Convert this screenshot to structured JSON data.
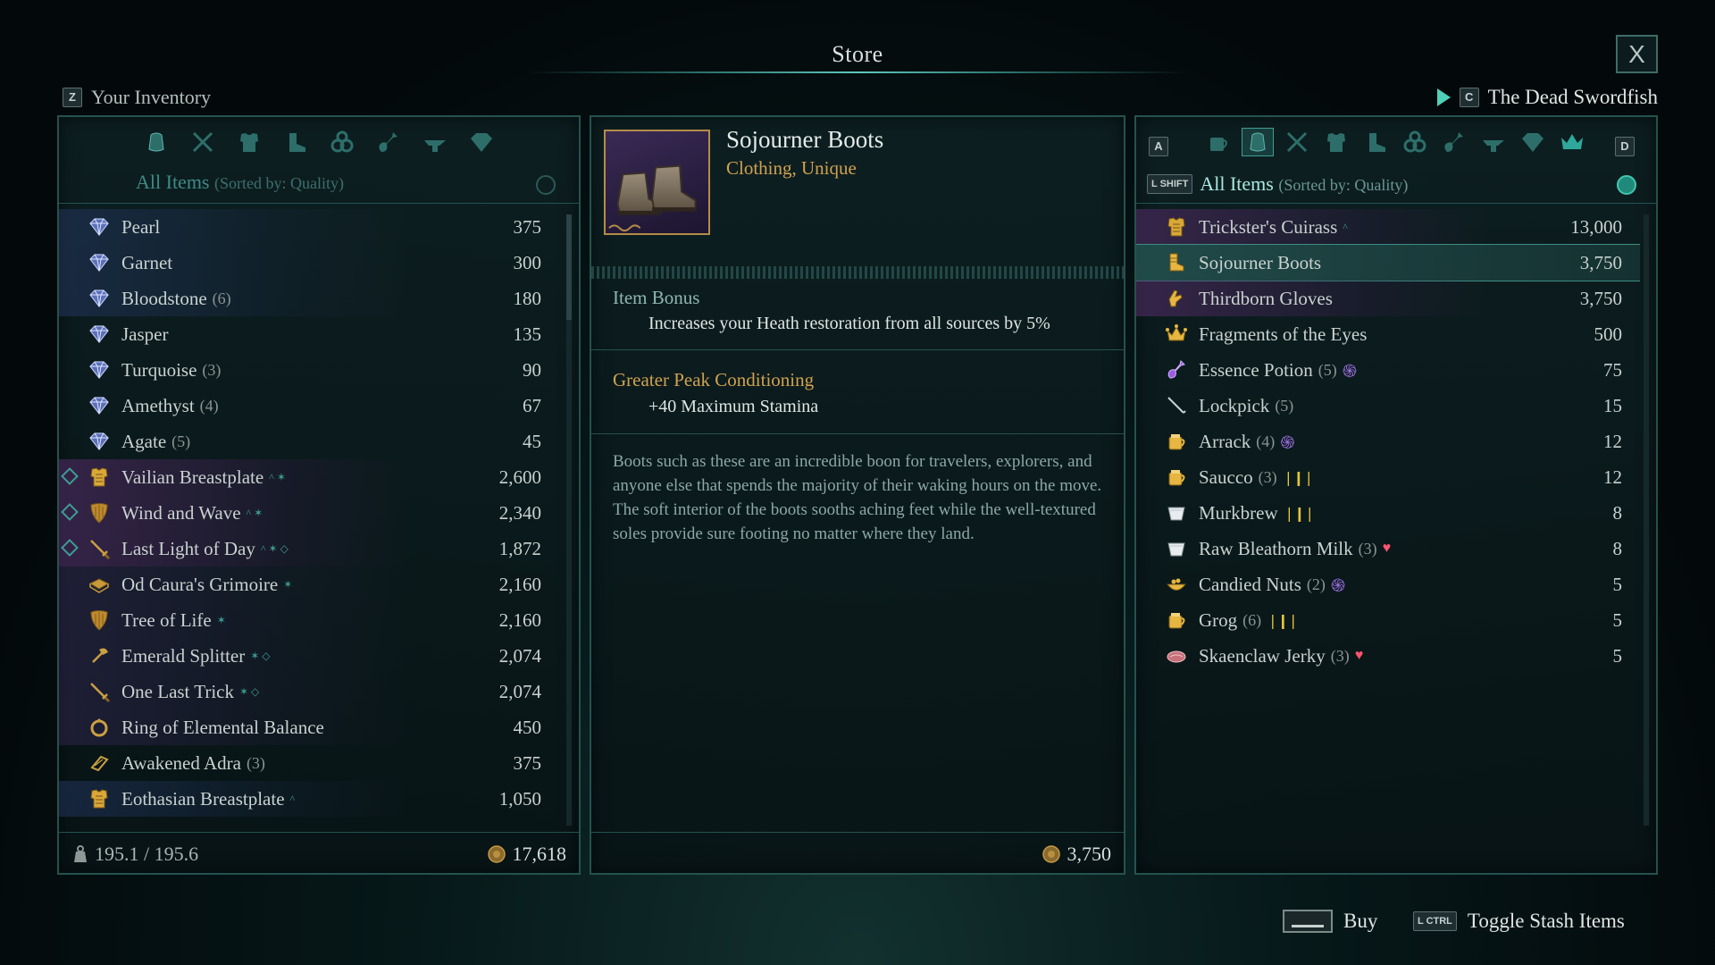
{
  "window": {
    "title": "Store",
    "close_label": "X"
  },
  "inventory_header": {
    "key": "Z",
    "label": "Your Inventory"
  },
  "vendor_header": {
    "key": "C",
    "label": "The Dead Swordfish"
  },
  "left_panel": {
    "filter_label": "All Items",
    "sort_label": "(Sorted by: Quality)",
    "categories": [
      "all-items-icon",
      "weapons-icon",
      "armor-icon",
      "clothing-icon",
      "rings-icon",
      "consumables-icon",
      "tools-icon",
      "gems-icon"
    ],
    "items": [
      {
        "name": "Pearl",
        "qty": "",
        "value": "375",
        "icon": "gem-icon",
        "style": "blue"
      },
      {
        "name": "Garnet",
        "qty": "",
        "value": "300",
        "icon": "gem-icon",
        "style": "blue"
      },
      {
        "name": "Bloodstone",
        "qty": "(6)",
        "value": "180",
        "icon": "gem-icon",
        "style": "blue"
      },
      {
        "name": "Jasper",
        "qty": "",
        "value": "135",
        "icon": "gem-icon",
        "style": ""
      },
      {
        "name": "Turquoise",
        "qty": "(3)",
        "value": "90",
        "icon": "gem-icon",
        "style": ""
      },
      {
        "name": "Amethyst",
        "qty": "(4)",
        "value": "67",
        "icon": "gem-icon",
        "style": ""
      },
      {
        "name": "Agate",
        "qty": "(5)",
        "value": "45",
        "icon": "gem-icon",
        "style": ""
      },
      {
        "name": "Vailian Breastplate",
        "qty": "",
        "value": "2,600",
        "icon": "armor-icon",
        "style": "purple",
        "equipped": true,
        "marks": "^ ✶"
      },
      {
        "name": "Wind and Wave",
        "qty": "",
        "value": "2,340",
        "icon": "shield-icon",
        "style": "purple",
        "equipped": true,
        "marks": "^ ✶"
      },
      {
        "name": "Last Light of Day",
        "qty": "",
        "value": "1,872",
        "icon": "sword-icon",
        "style": "purple",
        "equipped": true,
        "marks": "^ ✶ ◇"
      },
      {
        "name": "Od Caura's Grimoire",
        "qty": "",
        "value": "2,160",
        "icon": "grimoire-icon",
        "style": "purple2",
        "marks": "✶"
      },
      {
        "name": "Tree of Life",
        "qty": "",
        "value": "2,160",
        "icon": "shield-icon",
        "style": "purple2",
        "marks": "✶"
      },
      {
        "name": "Emerald Splitter",
        "qty": "",
        "value": "2,074",
        "icon": "axe-icon",
        "style": "purple2",
        "marks": "✶ ◇"
      },
      {
        "name": "One Last Trick",
        "qty": "",
        "value": "2,074",
        "icon": "sword-icon",
        "style": "purple2",
        "marks": "✶ ◇"
      },
      {
        "name": "Ring of Elemental Balance",
        "qty": "",
        "value": "450",
        "icon": "ring-icon",
        "style": "purple2"
      },
      {
        "name": "Awakened Adra",
        "qty": "(3)",
        "value": "375",
        "icon": "adra-icon",
        "style": ""
      },
      {
        "name": "Eothasian Breastplate",
        "qty": "",
        "value": "1,050",
        "icon": "armor-icon",
        "style": "blue",
        "marks": "^"
      }
    ],
    "weight": "195.1 / 195.6",
    "gold": "17,618"
  },
  "detail_panel": {
    "item_name": "Sojourner Boots",
    "item_type": "Clothing, Unique",
    "bonus_title": "Item Bonus",
    "bonus_text": "Increases your Heath restoration from all sources by 5%",
    "perk_title": "Greater Peak Conditioning",
    "perk_text": "+40 Maximum Stamina",
    "description": "Boots such as these are an incredible boon for travelers, explorers, and anyone else that spends the majority of their waking hours on the move. The soft interior of the boots sooths aching feet while the well-textured soles provide sure footing no matter where they land.",
    "price": "3,750"
  },
  "right_panel": {
    "key_left": "A",
    "key_right": "D",
    "shift_key": "L SHIFT",
    "filter_label": "All Items",
    "sort_label": "(Sorted by: Quality)",
    "categories": [
      "drinks-icon",
      "all-items-icon",
      "weapons-icon",
      "armor-icon",
      "clothing-icon",
      "rings-icon",
      "consumables-icon",
      "tools-icon",
      "gems-icon",
      "crown-icon"
    ],
    "items": [
      {
        "name": "Trickster's Cuirass",
        "qty": "",
        "value": "13,000",
        "icon": "armor-icon",
        "style": "purple",
        "marks": "^"
      },
      {
        "name": "Sojourner Boots",
        "qty": "",
        "value": "3,750",
        "icon": "boots-icon",
        "style": "selected"
      },
      {
        "name": "Thirdborn Gloves",
        "qty": "",
        "value": "3,750",
        "icon": "gloves-icon",
        "style": "purple"
      },
      {
        "name": "Fragments of the Eyes",
        "qty": "",
        "value": "500",
        "icon": "crown-icon",
        "style": ""
      },
      {
        "name": "Essence Potion",
        "qty": "(5)",
        "value": "75",
        "icon": "potion-icon",
        "style": "",
        "effect": "purple"
      },
      {
        "name": "Lockpick",
        "qty": "(5)",
        "value": "15",
        "icon": "lockpick-icon",
        "style": ""
      },
      {
        "name": "Arrack",
        "qty": "(4)",
        "value": "12",
        "icon": "bottle-icon",
        "style": "",
        "effect": "purple"
      },
      {
        "name": "Saucco",
        "qty": "(3)",
        "value": "12",
        "icon": "bottle-icon",
        "style": "",
        "effect": "yellow"
      },
      {
        "name": "Murkbrew",
        "qty": "",
        "value": "8",
        "icon": "mug-icon",
        "style": "",
        "effect": "yellow"
      },
      {
        "name": "Raw Bleathorn Milk",
        "qty": "(3)",
        "value": "8",
        "icon": "mug-icon",
        "style": "",
        "effect": "red"
      },
      {
        "name": "Candied Nuts",
        "qty": "(2)",
        "value": "5",
        "icon": "bowl-icon",
        "style": "",
        "effect": "purple"
      },
      {
        "name": "Grog",
        "qty": "(6)",
        "value": "5",
        "icon": "bottle-icon",
        "style": "",
        "effect": "yellow"
      },
      {
        "name": "Skaenclaw Jerky",
        "qty": "(3)",
        "value": "5",
        "icon": "meat-icon",
        "style": "",
        "effect": "red"
      }
    ]
  },
  "hints": [
    {
      "key": "space",
      "label": "Buy"
    },
    {
      "key": "L CTRL",
      "label": "Toggle Stash Items"
    }
  ],
  "colors": {
    "accent": "#3c9e94",
    "gold": "#d0a24f",
    "panel_border": "#24524f",
    "quality_purple": "#5a2d6e"
  }
}
